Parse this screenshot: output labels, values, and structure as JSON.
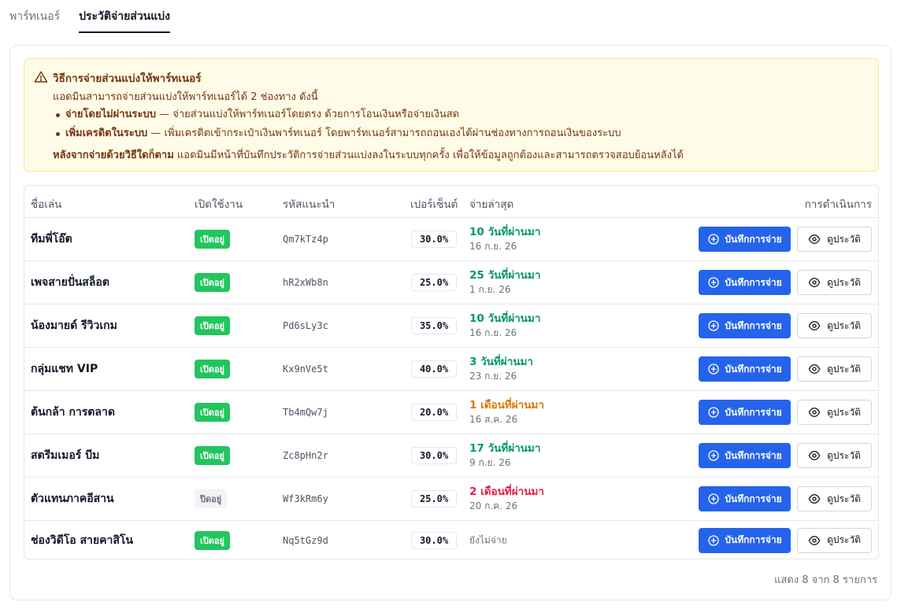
{
  "tabs": [
    {
      "label": "พาร์ทเนอร์",
      "active": false
    },
    {
      "label": "ประวัติจ่ายส่วนแบ่ง",
      "active": true
    }
  ],
  "notice": {
    "icon": "warning-icon",
    "title": "วิธีการจ่ายส่วนแบ่งให้พาร์ทเนอร์",
    "intro": "แอดมินสามารถจ่ายส่วนแบ่งให้พาร์ทเนอร์ได้ 2 ช่องทาง ดังนี้",
    "items": [
      {
        "bold": "จ่ายโดยไม่ผ่านระบบ",
        "text": " — จ่ายส่วนแบ่งให้พาร์ทเนอร์โดยตรง ด้วยการโอนเงินหรือจ่ายเงินสด"
      },
      {
        "bold": "เพิ่มเครดิตในระบบ",
        "text": " — เพิ่มเครดิตเข้ากระเป๋าเงินพาร์ทเนอร์ โดยพาร์ทเนอร์สามารถถอนเองได้ผ่านช่องทางการถอนเงินของระบบ"
      }
    ],
    "footer_bold": "หลังจากจ่ายด้วยวิธีใดก็ตาม",
    "footer_text": " แอดมินมีหน้าที่บันทึกประวัติการจ่ายส่วนแบ่งลงในระบบทุกครั้ง เพื่อให้ข้อมูลถูกต้องและสามารถตรวจสอบย้อนหลังได้"
  },
  "table": {
    "headers": {
      "name": "ชื่อเล่น",
      "status": "เปิดใช้งาน",
      "code": "รหัสแนะนำ",
      "percent": "เปอร์เซ็นต์",
      "last_paid": "จ่ายล่าสุด",
      "actions": "การดำเนินการ"
    },
    "pay_button_label": "บันทึกการจ่าย",
    "view_button_label": "ดูประวัติ",
    "rows": [
      {
        "name": "ทีมพี่โอ๊ต",
        "status": "เปิดอยู่",
        "active": true,
        "code": "Qm7kTz4p",
        "percent": "30.0%",
        "last_rel": "10 วันที่ผ่านมา",
        "last_date": "16 ก.ย. 26",
        "tone": "green"
      },
      {
        "name": "เพจสายปั่นสล็อต",
        "status": "เปิดอยู่",
        "active": true,
        "code": "hR2xWb8n",
        "percent": "25.0%",
        "last_rel": "25 วันที่ผ่านมา",
        "last_date": "1 ก.ย. 26",
        "tone": "green"
      },
      {
        "name": "น้องมายด์ รีวิวเกม",
        "status": "เปิดอยู่",
        "active": true,
        "code": "Pd6sLy3c",
        "percent": "35.0%",
        "last_rel": "10 วันที่ผ่านมา",
        "last_date": "16 ก.ย. 26",
        "tone": "green"
      },
      {
        "name": "กลุ่มแชท VIP",
        "status": "เปิดอยู่",
        "active": true,
        "code": "Kx9nVe5t",
        "percent": "40.0%",
        "last_rel": "3 วันที่ผ่านมา",
        "last_date": "23 ก.ย. 26",
        "tone": "green"
      },
      {
        "name": "ต้นกล้า การตลาด",
        "status": "เปิดอยู่",
        "active": true,
        "code": "Tb4mQw7j",
        "percent": "20.0%",
        "last_rel": "1 เดือนที่ผ่านมา",
        "last_date": "16 ส.ค. 26",
        "tone": "orange"
      },
      {
        "name": "สตรีมเมอร์ บีม",
        "status": "เปิดอยู่",
        "active": true,
        "code": "Zc8pHn2r",
        "percent": "30.0%",
        "last_rel": "17 วันที่ผ่านมา",
        "last_date": "9 ก.ย. 26",
        "tone": "green"
      },
      {
        "name": "ตัวแทนภาคอีสาน",
        "status": "ปิดอยู่",
        "active": false,
        "code": "Wf3kRm6y",
        "percent": "25.0%",
        "last_rel": "2 เดือนที่ผ่านมา",
        "last_date": "20 ก.ค. 26",
        "tone": "red"
      },
      {
        "name": "ช่องวิดีโอ สายคาสิโน",
        "status": "เปิดอยู่",
        "active": true,
        "code": "Nq5tGz9d",
        "percent": "30.0%",
        "last_rel": "",
        "last_date": "",
        "never": "ยังไม่จ่าย",
        "tone": "none"
      }
    ]
  },
  "summary": "แสดง 8 จาก 8 รายการ",
  "colors": {
    "primary": "#2563eb",
    "success": "#22c55e",
    "recent": "#059669",
    "warning": "#d97706",
    "danger": "#e11d48",
    "notice_bg": "#fefce8"
  }
}
